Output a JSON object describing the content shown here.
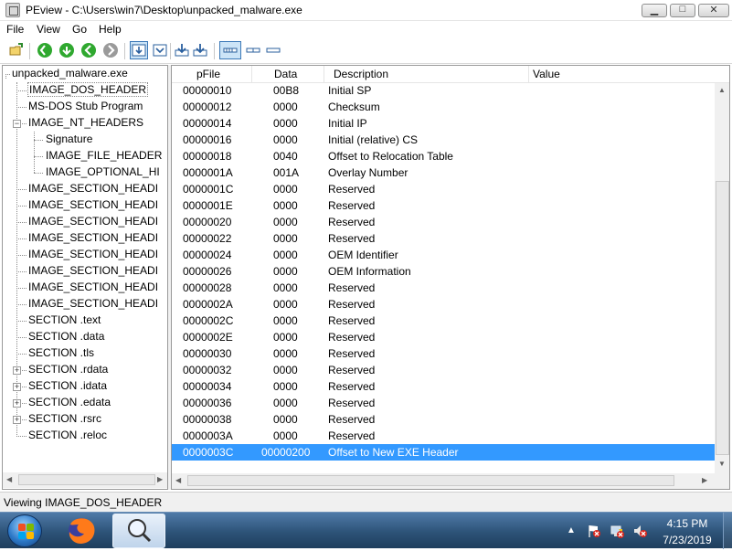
{
  "window": {
    "title": "PEview - C:\\Users\\win7\\Desktop\\unpacked_malware.exe",
    "buttons": {
      "minimize_glyph": "▁",
      "maximize_glyph": "□",
      "close_glyph": "✕"
    }
  },
  "menu": {
    "file": "File",
    "view": "View",
    "go": "Go",
    "help": "Help"
  },
  "toolbar": {
    "icons": [
      "open-icon",
      "back-icon",
      "forward-icon",
      "previous-icon",
      "next-icon",
      "view-hex-icon",
      "view-text-icon",
      "save-icon",
      "save-all-icon",
      "byte-view-icon",
      "word-view-icon",
      "dword-view-icon"
    ]
  },
  "tree": {
    "root": "unpacked_malware.exe",
    "items": [
      {
        "label": "IMAGE_DOS_HEADER",
        "level": 1
      },
      {
        "label": "MS-DOS Stub Program",
        "level": 1
      },
      {
        "label": "IMAGE_NT_HEADERS",
        "level": 1
      },
      {
        "label": "Signature",
        "level": 2
      },
      {
        "label": "IMAGE_FILE_HEADER",
        "level": 2
      },
      {
        "label": "IMAGE_OPTIONAL_HI",
        "level": 2
      },
      {
        "label": "IMAGE_SECTION_HEADI",
        "level": 1
      },
      {
        "label": "IMAGE_SECTION_HEADI",
        "level": 1
      },
      {
        "label": "IMAGE_SECTION_HEADI",
        "level": 1
      },
      {
        "label": "IMAGE_SECTION_HEADI",
        "level": 1
      },
      {
        "label": "IMAGE_SECTION_HEADI",
        "level": 1
      },
      {
        "label": "IMAGE_SECTION_HEADI",
        "level": 1
      },
      {
        "label": "IMAGE_SECTION_HEADI",
        "level": 1
      },
      {
        "label": "IMAGE_SECTION_HEADI",
        "level": 1
      },
      {
        "label": "SECTION .text",
        "level": 1
      },
      {
        "label": "SECTION .data",
        "level": 1
      },
      {
        "label": "SECTION .tls",
        "level": 1
      },
      {
        "label": "SECTION .rdata",
        "level": 1
      },
      {
        "label": "SECTION .idata",
        "level": 1
      },
      {
        "label": "SECTION .edata",
        "level": 1
      },
      {
        "label": "SECTION .rsrc",
        "level": 1
      },
      {
        "label": "SECTION .reloc",
        "level": 1
      }
    ]
  },
  "columns": {
    "pfile": "pFile",
    "data": "Data",
    "description": "Description",
    "value": "Value"
  },
  "rows": [
    {
      "pfile": "00000010",
      "data": "00B8",
      "description": "Initial SP"
    },
    {
      "pfile": "00000012",
      "data": "0000",
      "description": "Checksum"
    },
    {
      "pfile": "00000014",
      "data": "0000",
      "description": "Initial IP"
    },
    {
      "pfile": "00000016",
      "data": "0000",
      "description": "Initial (relative) CS"
    },
    {
      "pfile": "00000018",
      "data": "0040",
      "description": "Offset to Relocation Table"
    },
    {
      "pfile": "0000001A",
      "data": "001A",
      "description": "Overlay Number"
    },
    {
      "pfile": "0000001C",
      "data": "0000",
      "description": "Reserved"
    },
    {
      "pfile": "0000001E",
      "data": "0000",
      "description": "Reserved"
    },
    {
      "pfile": "00000020",
      "data": "0000",
      "description": "Reserved"
    },
    {
      "pfile": "00000022",
      "data": "0000",
      "description": "Reserved"
    },
    {
      "pfile": "00000024",
      "data": "0000",
      "description": "OEM Identifier"
    },
    {
      "pfile": "00000026",
      "data": "0000",
      "description": "OEM Information"
    },
    {
      "pfile": "00000028",
      "data": "0000",
      "description": "Reserved"
    },
    {
      "pfile": "0000002A",
      "data": "0000",
      "description": "Reserved"
    },
    {
      "pfile": "0000002C",
      "data": "0000",
      "description": "Reserved"
    },
    {
      "pfile": "0000002E",
      "data": "0000",
      "description": "Reserved"
    },
    {
      "pfile": "00000030",
      "data": "0000",
      "description": "Reserved"
    },
    {
      "pfile": "00000032",
      "data": "0000",
      "description": "Reserved"
    },
    {
      "pfile": "00000034",
      "data": "0000",
      "description": "Reserved"
    },
    {
      "pfile": "00000036",
      "data": "0000",
      "description": "Reserved"
    },
    {
      "pfile": "00000038",
      "data": "0000",
      "description": "Reserved"
    },
    {
      "pfile": "0000003A",
      "data": "0000",
      "description": "Reserved"
    },
    {
      "pfile": "0000003C",
      "data": "00000200",
      "description": "Offset to New EXE Header"
    }
  ],
  "status": {
    "text": "Viewing IMAGE_DOS_HEADER"
  },
  "taskbar": {
    "apps": [
      "windows-start-orb",
      "firefox-icon",
      "peview-magnifier-icon"
    ],
    "clock_time": "4:15 PM",
    "clock_date": "7/23/2019"
  },
  "colors": {
    "selection": "#3399ff",
    "taskbar": "#2d5378"
  }
}
